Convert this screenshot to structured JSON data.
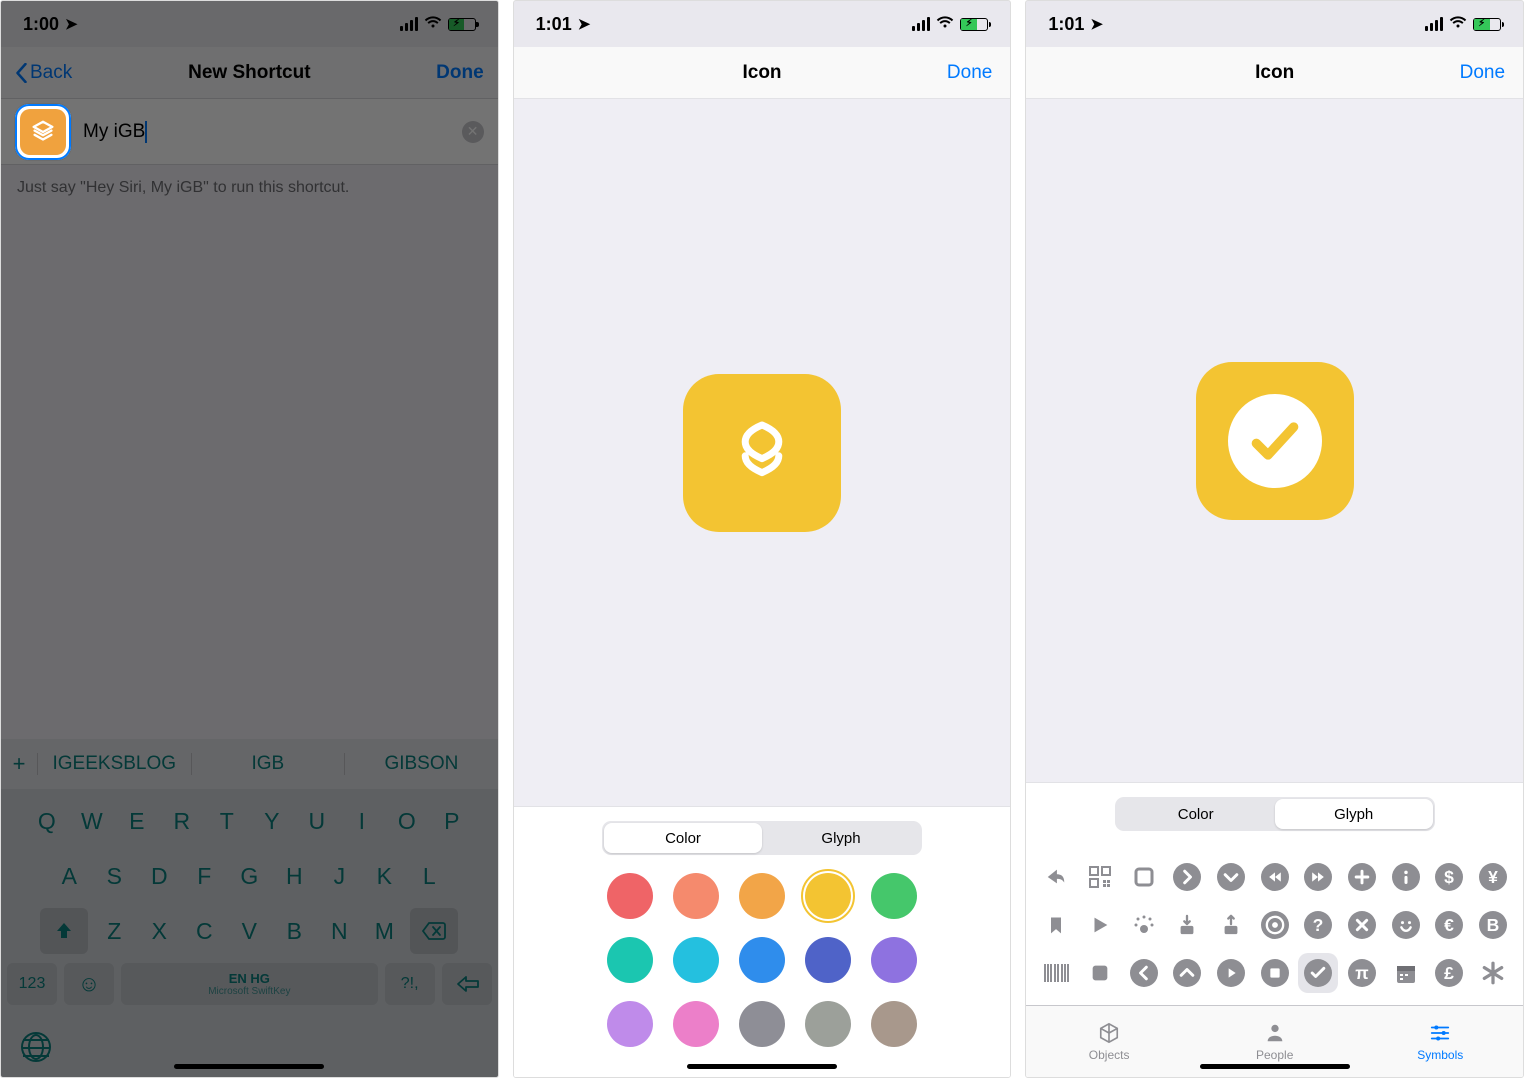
{
  "screen1": {
    "statusTime": "1:00",
    "back": "Back",
    "navTitle": "New Shortcut",
    "done": "Done",
    "inputValue": "My iGB",
    "hint": "Just say \"Hey Siri, My iGB\" to run this shortcut.",
    "predict": {
      "w1": "IGEEKSBLOG",
      "w2": "IGB",
      "w3": "GIBSON"
    },
    "keys": {
      "r1": [
        "Q",
        "W",
        "E",
        "R",
        "T",
        "Y",
        "U",
        "I",
        "O",
        "P"
      ],
      "r2": [
        "A",
        "S",
        "D",
        "F",
        "G",
        "H",
        "J",
        "K",
        "L"
      ],
      "r3": [
        "Z",
        "X",
        "C",
        "V",
        "B",
        "N",
        "M"
      ]
    },
    "kbot": {
      "num": "123",
      "spaceTop": "EN HG",
      "spaceBottom": "Microsoft SwiftKey",
      "punct": "?!,"
    }
  },
  "screen2": {
    "statusTime": "1:01",
    "navTitle": "Icon",
    "done": "Done",
    "seg": {
      "color": "Color",
      "glyph": "Glyph"
    },
    "colors": [
      "#ef6467",
      "#f58a6d",
      "#f2a548",
      "#f3c432",
      "#45c76b",
      "#1bc6b0",
      "#24c0df",
      "#2f8dec",
      "#4f63c8",
      "#8e72e0",
      "#bf8bea",
      "#ec7fc9",
      "#8e8e96",
      "#9ca09a",
      "#a8988c"
    ],
    "selectedColor": 3
  },
  "screen3": {
    "statusTime": "1:01",
    "navTitle": "Icon",
    "done": "Done",
    "seg": {
      "color": "Color",
      "glyph": "Glyph"
    },
    "tabs": {
      "objects": "Objects",
      "people": "People",
      "symbols": "Symbols"
    },
    "glyphRows": [
      [
        "share-arrow",
        "qr",
        "square",
        "chevron-right",
        "chevron-down",
        "rewind",
        "forward",
        "plus",
        "info",
        "dollar",
        "yen"
      ],
      [
        "bookmark",
        "play",
        "touch",
        "download",
        "upload",
        "target",
        "question",
        "x",
        "smile",
        "euro",
        "bitcoin"
      ],
      [
        "barcode",
        "stop-square",
        "chevron-left",
        "chevron-up",
        "play-circle",
        "stop-circle",
        "check",
        "pi",
        "calendar",
        "pound",
        "asterisk"
      ]
    ],
    "selectedGlyph": "check"
  }
}
